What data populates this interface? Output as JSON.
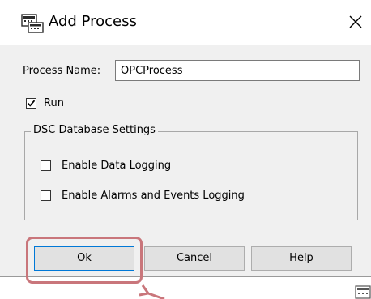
{
  "dialog": {
    "title": "Add Process",
    "close_glyph": "✕"
  },
  "form": {
    "process_name_label": "Process Name:",
    "process_name_value": "OPCProcess",
    "run_label": "Run",
    "run_checked": true
  },
  "dsc_group": {
    "title": "DSC Database Settings",
    "data_logging_label": "Enable Data Logging",
    "data_logging_checked": false,
    "alarms_events_label": "Enable Alarms and Events Logging",
    "alarms_events_checked": false
  },
  "buttons": {
    "ok": "Ok",
    "cancel": "Cancel",
    "help": "Help"
  },
  "annotation": {
    "highlight_color": "#c9767b"
  },
  "icons": {
    "title_icon": "process-window-icon",
    "close": "close-icon",
    "corner": "process-window-icon"
  }
}
